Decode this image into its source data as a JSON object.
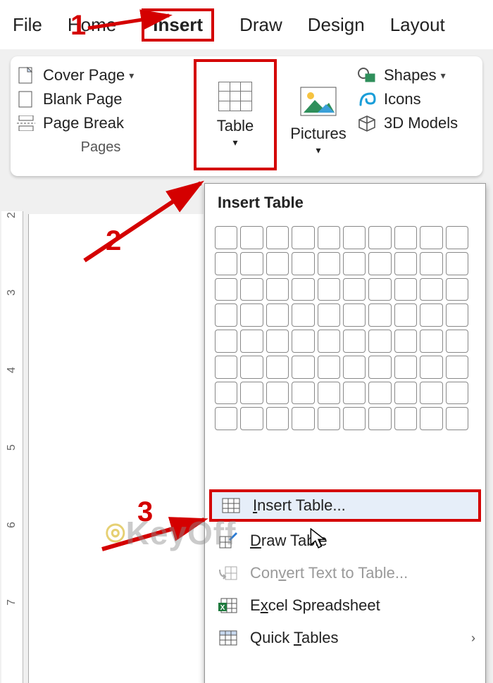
{
  "tabs": {
    "file": "File",
    "home": "Home",
    "insert": "Insert",
    "draw": "Draw",
    "design": "Design",
    "layout": "Layout"
  },
  "ribbon": {
    "pages": {
      "cover": "Cover Page",
      "blank": "Blank Page",
      "break": "Page Break",
      "group": "Pages"
    },
    "table": {
      "label": "Table"
    },
    "pictures": {
      "label": "Pictures"
    },
    "ill": {
      "shapes": "Shapes",
      "icons": "Icons",
      "models": "3D Models"
    }
  },
  "menu": {
    "title": "Insert Table",
    "grid": {
      "cols": 10,
      "rows": 8
    },
    "items": [
      {
        "acc": "I",
        "rest": "nsert Table...",
        "full": "Insert Table..."
      },
      {
        "acc": "D",
        "rest": "raw Table",
        "full": "Draw Table"
      },
      {
        "pre": "Con",
        "acc": "v",
        "rest": "ert Text to Table...",
        "full": "Convert Text to Table...",
        "disabled": true
      },
      {
        "pre": "E",
        "acc": "x",
        "rest": "cel Spreadsheet",
        "full": "Excel Spreadsheet"
      },
      {
        "pre": "Quick ",
        "acc": "T",
        "rest": "ables",
        "full": "Quick Tables",
        "submenu": true
      }
    ]
  },
  "ruler": [
    "2",
    "3",
    "4",
    "5",
    "6",
    "7"
  ],
  "annotations": {
    "n1": "1",
    "n2": "2",
    "n3": "3"
  },
  "watermark": "KeyOff",
  "colors": {
    "highlight_border": "#d40000",
    "menu_hover": "#e6eef9"
  }
}
